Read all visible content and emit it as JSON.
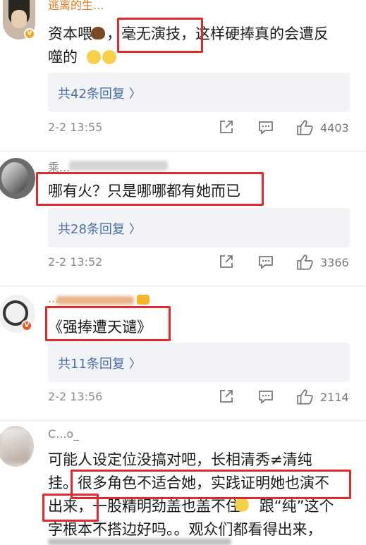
{
  "comments": [
    {
      "username": "逃离的生...",
      "text_lines": [
        "资本喂   ，毫无演技，这样硬捧真的会遭反",
        "噬的"
      ],
      "reply_link": "共42条回复 〉",
      "timestamp": "2-2 13:55",
      "likes": "4403"
    },
    {
      "username": "乘...",
      "text_lines": [
        "哪有火？只是哪哪都有她而已"
      ],
      "reply_link": "共28条回复 〉",
      "timestamp": "2-2 13:52",
      "likes": "3366"
    },
    {
      "username": "...",
      "text_lines": [
        "《强捧遭天谴》"
      ],
      "reply_link": "共11条回复 〉",
      "timestamp": "2-2 13:56",
      "likes": "2114"
    },
    {
      "username": "C...o_",
      "text_lines": [
        "可能人设定位没搞对吧，长相清秀≠清纯",
        "挂。很多角色不适合她，实践证明她也演不",
        "出来，一股精明劲盖也盖不住    跟“纯”这个",
        "字根本不搭边好吗。。观众们都看得出来，"
      ]
    }
  ],
  "colors": {
    "highlight": "#e12a2a",
    "link": "#4a6fa5",
    "verified": "#f5a623"
  },
  "icons": [
    "share-icon",
    "comment-icon",
    "like-icon"
  ]
}
